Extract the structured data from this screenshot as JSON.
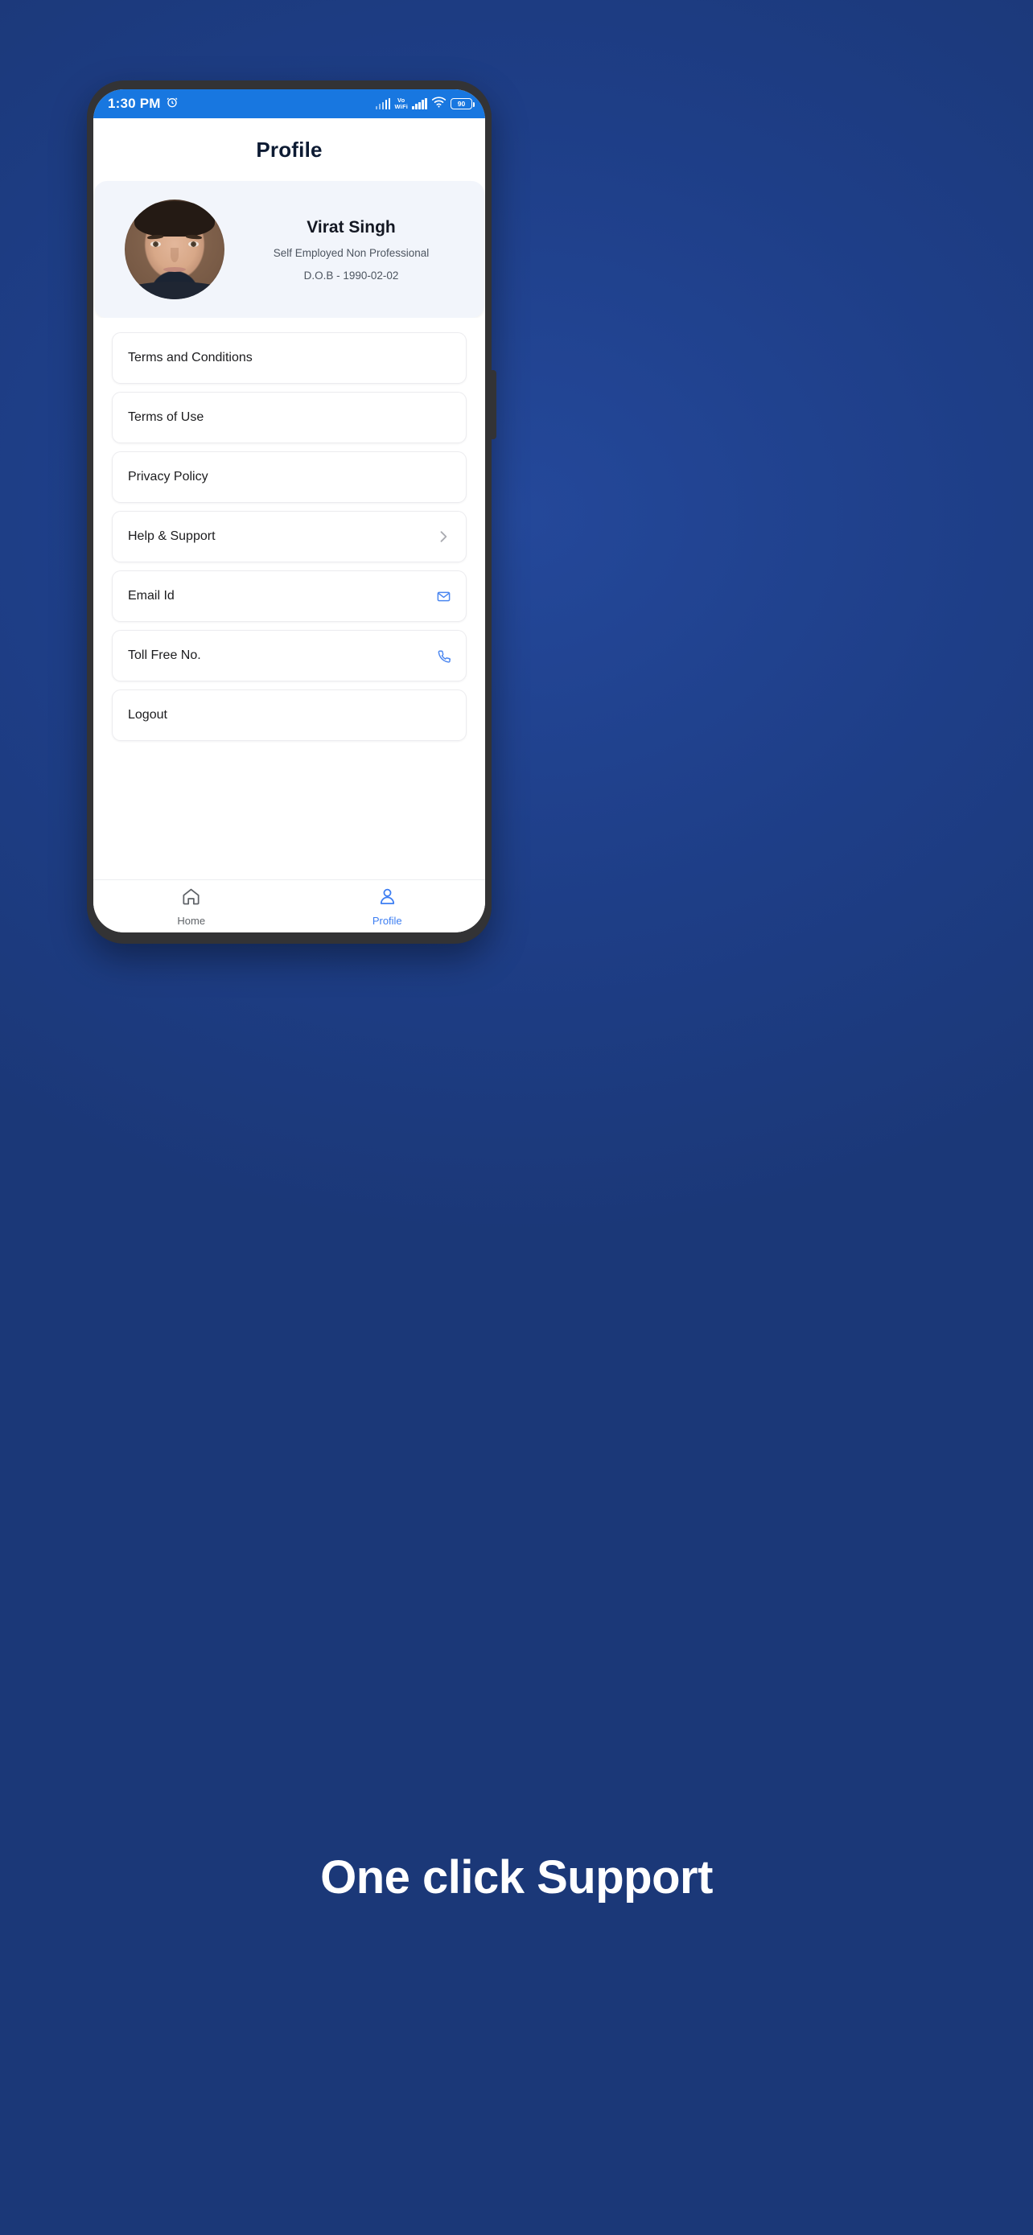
{
  "background_color": "#1e3e87",
  "status_bar": {
    "time": "1:30 PM",
    "alarm_icon": "alarm-clock-icon",
    "vo_text": "Vo",
    "wifi_text": "WiFi",
    "battery_level": "90",
    "bar_color": "#1877e0"
  },
  "header": {
    "title": "Profile"
  },
  "profile": {
    "avatar": "user-photo",
    "name": "Virat Singh",
    "occupation": "Self Employed Non Professional",
    "dob": "D.O.B - 1990-02-02",
    "card_color": "#f2f5fb"
  },
  "menu": {
    "items": [
      {
        "label": "Terms and Conditions",
        "icon": ""
      },
      {
        "label": "Terms of Use",
        "icon": ""
      },
      {
        "label": "Privacy Policy",
        "icon": ""
      },
      {
        "label": "Help & Support",
        "icon": "chevron-right-icon"
      },
      {
        "label": "Email Id",
        "icon": "envelope-icon"
      },
      {
        "label": "Toll Free No.",
        "icon": "phone-icon"
      },
      {
        "label": "Logout",
        "icon": ""
      }
    ]
  },
  "bottom_nav": {
    "items": [
      {
        "label": "Home",
        "icon": "home-icon",
        "active": false
      },
      {
        "label": "Profile",
        "icon": "person-icon",
        "active": true
      }
    ],
    "active_color": "#3d7ef2",
    "inactive_color": "#5f6368"
  },
  "caption": {
    "text": "One click Support"
  }
}
